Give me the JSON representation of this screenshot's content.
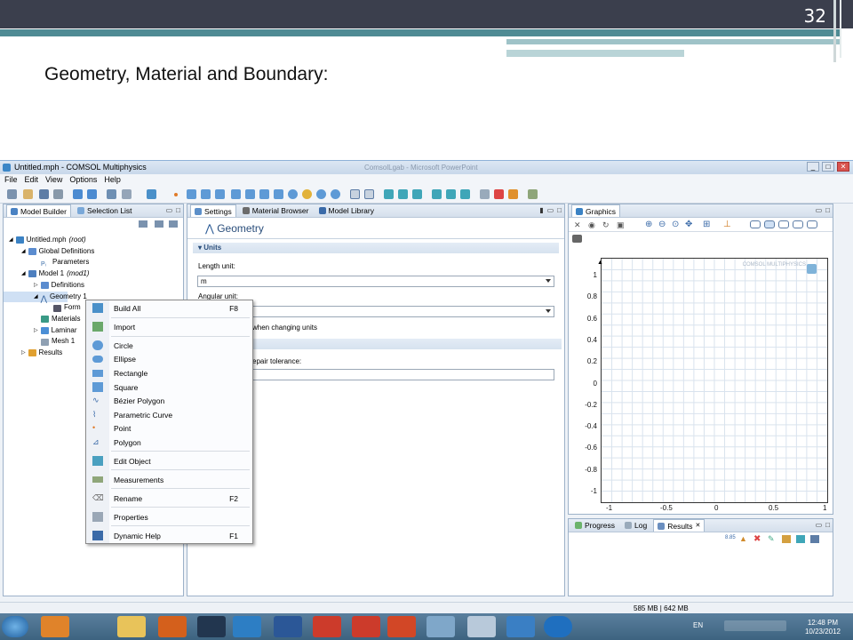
{
  "slide": {
    "number": "32",
    "title": "Geometry, Material and Boundary:"
  },
  "window": {
    "title": "Untitled.mph - COMSOL Multiphysics",
    "ghost_title": "ComsolLgab - Microsoft PowerPoint",
    "menu": [
      "File",
      "Edit",
      "View",
      "Options",
      "Help"
    ]
  },
  "left_pane": {
    "tabs": [
      "Model Builder",
      "Selection List"
    ],
    "tree": [
      {
        "label": "Untitled.mph",
        "suffix": "(root)"
      },
      {
        "label": "Global Definitions",
        "suffix": ""
      },
      {
        "label": "Parameters",
        "suffix": ""
      },
      {
        "label": "Model 1",
        "suffix": "(mod1)"
      },
      {
        "label": "Definitions",
        "suffix": ""
      },
      {
        "label": "Geometry 1",
        "suffix": ""
      },
      {
        "label": "Form",
        "suffix": ""
      },
      {
        "label": "Materials",
        "suffix": ""
      },
      {
        "label": "Laminar",
        "suffix": ""
      },
      {
        "label": "Mesh 1",
        "suffix": ""
      },
      {
        "label": "Results",
        "suffix": ""
      }
    ]
  },
  "context_menu": {
    "items": [
      {
        "label": "Build All",
        "key": "F8"
      },
      {
        "label": "Import",
        "key": ""
      },
      {
        "label": "Circle",
        "key": ""
      },
      {
        "label": "Ellipse",
        "key": ""
      },
      {
        "label": "Rectangle",
        "key": ""
      },
      {
        "label": "Square",
        "key": ""
      },
      {
        "label": "Bézier Polygon",
        "key": ""
      },
      {
        "label": "Parametric Curve",
        "key": ""
      },
      {
        "label": "Point",
        "key": ""
      },
      {
        "label": "Polygon",
        "key": ""
      },
      {
        "label": "Edit Object",
        "key": ""
      },
      {
        "label": "Measurements",
        "key": ""
      },
      {
        "label": "Rename",
        "key": "F2"
      },
      {
        "label": "Properties",
        "key": ""
      },
      {
        "label": "Dynamic Help",
        "key": "F1"
      }
    ]
  },
  "settings": {
    "tabs": [
      "Settings",
      "Material Browser",
      "Model Library"
    ],
    "heading": "Geometry",
    "section_units": "Units",
    "length_label": "Length unit:",
    "length_value": "m",
    "angular_label": "Angular unit:",
    "checkbox_fragment": "when changing units",
    "repair_fragment": "epair tolerance:"
  },
  "graphics": {
    "tab": "Graphics",
    "logo": "COMSOL MULTIPHYSICS",
    "y_ticks": [
      "1",
      "0.8",
      "0.6",
      "0.4",
      "0.2",
      "0",
      "-0.2",
      "-0.4",
      "-0.6",
      "-0.8",
      "-1"
    ],
    "x_ticks": [
      "-1",
      "-0.5",
      "0",
      "0.5",
      "1"
    ]
  },
  "bottom_pane": {
    "tabs": [
      "Progress",
      "Log",
      "Results"
    ]
  },
  "status": {
    "memory": "585 MB | 642 MB"
  },
  "taskbar": {
    "lang": "EN",
    "time": "12:48 PM",
    "date": "10/23/2012"
  }
}
